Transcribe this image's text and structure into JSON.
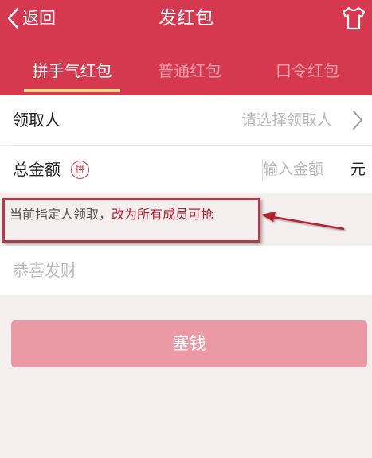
{
  "navbar": {
    "back_label": "返回",
    "title": "发红包",
    "back_icon": "chevron-left-icon",
    "right_icon": "tshirt-icon"
  },
  "tabs": [
    {
      "label": "拼手气红包",
      "active": true
    },
    {
      "label": "普通红包",
      "active": false
    },
    {
      "label": "口令红包",
      "active": false
    }
  ],
  "recipient": {
    "label": "领取人",
    "placeholder": "请选择领取人"
  },
  "amount": {
    "label": "总金额",
    "badge": "拼",
    "placeholder": "输入金额",
    "unit": "元"
  },
  "notice": {
    "text": "当前指定人领取，",
    "link": "改为所有成员可抢"
  },
  "greeting": {
    "placeholder": "恭喜发财"
  },
  "submit": {
    "label": "塞钱"
  },
  "colors": {
    "brand_red": "#d6394f",
    "tab_inactive": "#e9a0ab",
    "tab_underline": "#ffd48a",
    "button_disabled": "#e99aa4",
    "annotation_red": "#b33a47"
  }
}
